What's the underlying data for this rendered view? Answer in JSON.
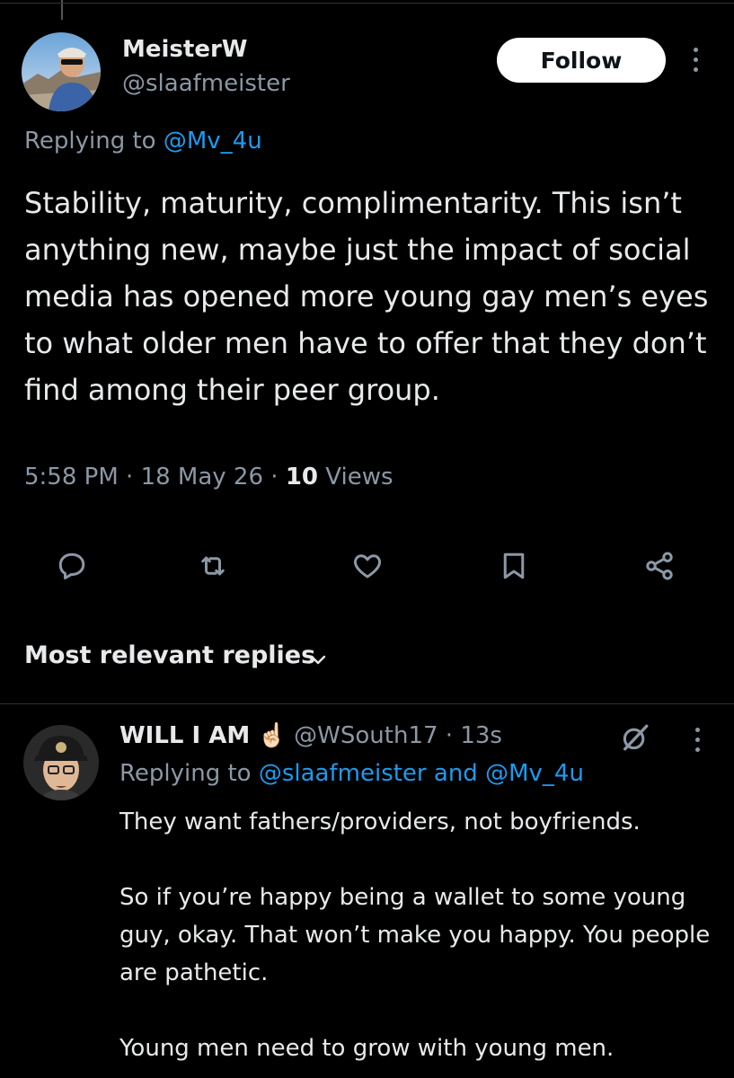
{
  "tweet": {
    "author_name": "MeisterW",
    "author_handle": "@slaafmeister",
    "follow_label": "Follow",
    "replying_prefix": "Replying to ",
    "replying_to": "@Mv_4u",
    "text": "Stability, maturity, complimentarity. This isn’t anything new, maybe just the impact of social media has opened more young gay men’s eyes to what older men have to offer that they don’t find among their peer group.",
    "time": "5:58 PM",
    "date": "18 May 26",
    "views_count": "10",
    "views_label": "Views"
  },
  "actions": {
    "icons": [
      "reply-icon",
      "retweet-icon",
      "like-icon",
      "bookmark-icon",
      "share-icon"
    ]
  },
  "replies_sort": {
    "label": "Most relevant replies"
  },
  "reply": {
    "author_name": "WILL I AM",
    "emoji": "☝🏻",
    "author_handle": "@WSouth17",
    "time": "13s",
    "replying_prefix": "Replying to ",
    "replying_to_1": "@slaafmeister",
    "replying_joiner": " and ",
    "replying_to_2": "@Mv_4u",
    "paragraphs": [
      "They want fathers/providers, not boyfriends.",
      "So if you’re happy being a wallet to some young guy, okay. That won’t make you happy. You people are pathetic.",
      "Young men need to grow with young men."
    ]
  },
  "colors": {
    "background": "#000000",
    "text": "#e7e9ea",
    "secondary": "#8b98a5",
    "link": "#1d9bf0",
    "follow_bg": "#ffffff"
  }
}
